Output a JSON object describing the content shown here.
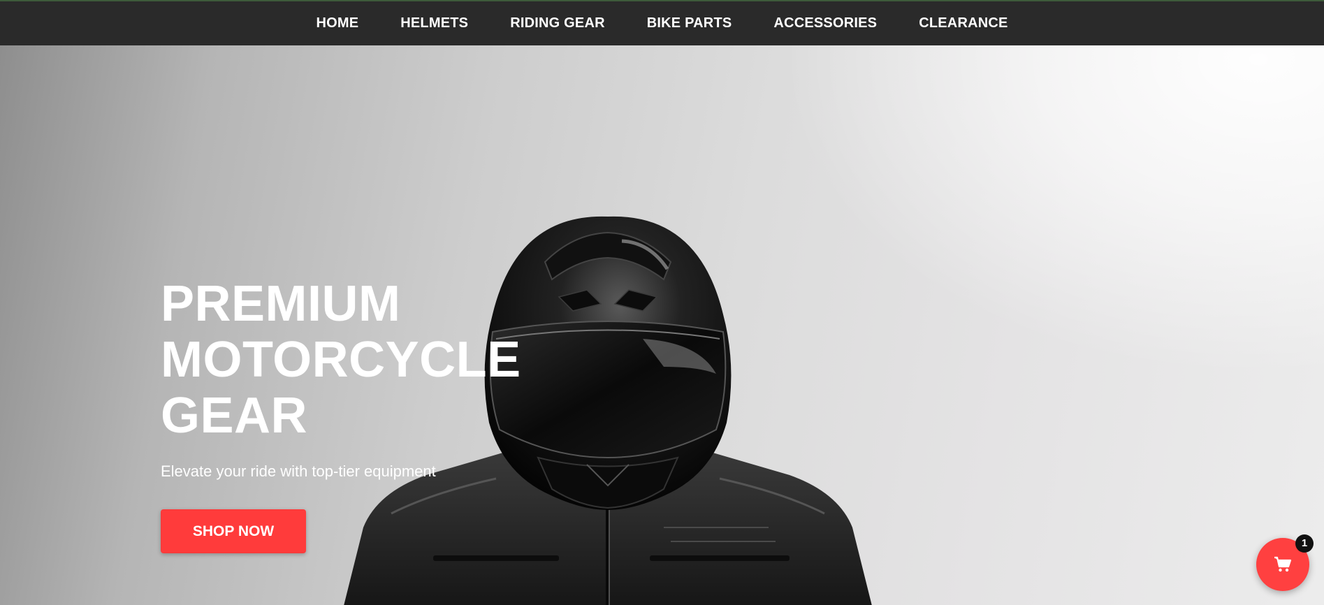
{
  "nav": {
    "items": [
      {
        "label": "HOME"
      },
      {
        "label": "HELMETS"
      },
      {
        "label": "RIDING GEAR"
      },
      {
        "label": "BIKE PARTS"
      },
      {
        "label": "ACCESSORIES"
      },
      {
        "label": "CLEARANCE"
      }
    ]
  },
  "hero": {
    "title": "PREMIUM\nMOTORCYCLE\nGEAR",
    "subtitle": "Elevate your ride with top-tier equipment",
    "cta_label": "SHOP NOW",
    "image_icon": "helmeted-rider-image"
  },
  "cart": {
    "icon": "cart-icon",
    "count": "1"
  },
  "colors": {
    "accent": "#ff3b3b",
    "navbar": "#2a2a2a",
    "badge": "#111111"
  }
}
